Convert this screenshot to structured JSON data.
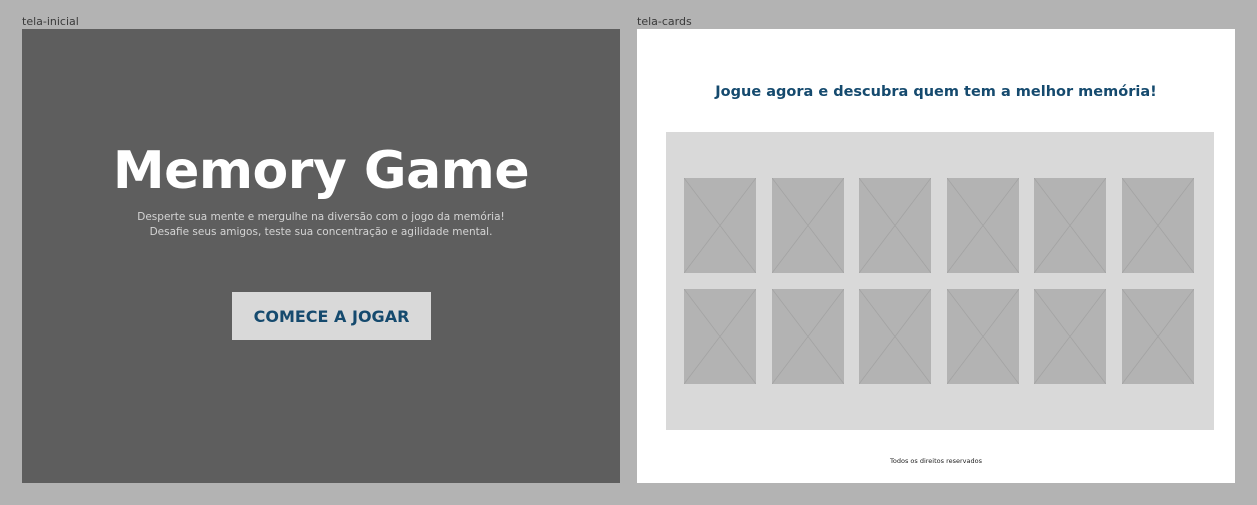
{
  "frames": {
    "start_label": "tela-inicial",
    "cards_label": "tela-cards"
  },
  "start_screen": {
    "title": "Memory Game",
    "subtitle_line1": "Desperte sua mente e mergulhe na diversão com o jogo da memória!",
    "subtitle_line2": "Desafie seus amigos, teste sua concentração e agilidade mental.",
    "button_label": "COMECE A JOGAR"
  },
  "cards_screen": {
    "heading": "Jogue agora e descubra quem tem a melhor memória!",
    "footer": "Todos os direitos reservados",
    "card_rows": 2,
    "card_cols": 6,
    "card_icon": "image-placeholder-icon"
  },
  "colors": {
    "canvas": "#b3b3b3",
    "start_bg": "#5e5e5e",
    "accent": "#154a6e",
    "board_bg": "#d9d9d9",
    "card_bg": "#b3b3b3"
  }
}
